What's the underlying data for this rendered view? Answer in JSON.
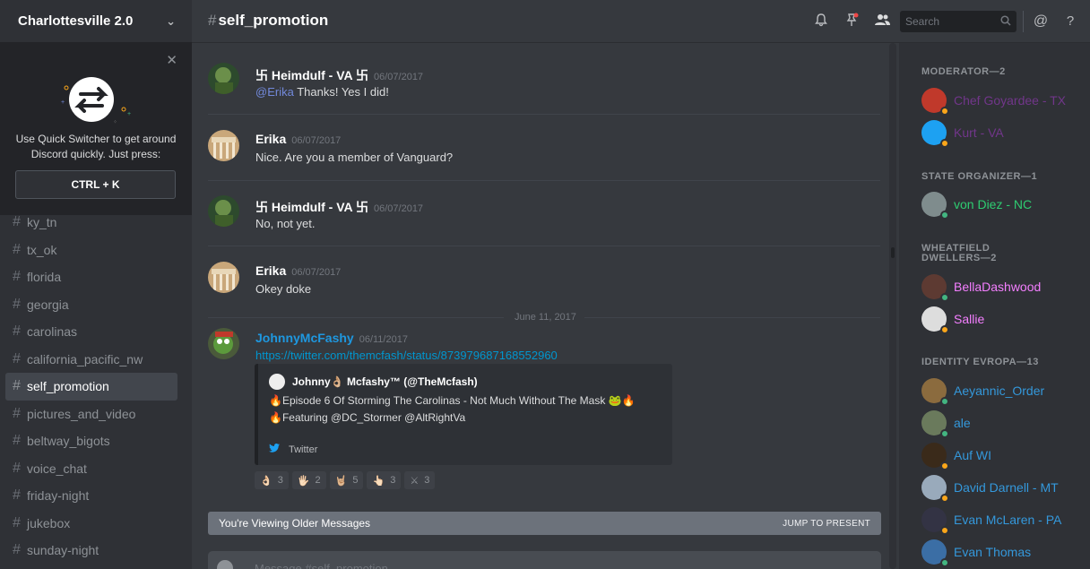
{
  "server": {
    "name": "Charlottesville 2.0"
  },
  "quick_switcher": {
    "text": "Use Quick Switcher to get around Discord quickly. Just press:",
    "shortcut": "CTRL + K"
  },
  "channels": [
    {
      "name": "ky_tn"
    },
    {
      "name": "tx_ok"
    },
    {
      "name": "florida"
    },
    {
      "name": "georgia"
    },
    {
      "name": "carolinas"
    },
    {
      "name": "california_pacific_nw"
    },
    {
      "name": "self_promotion",
      "active": true
    },
    {
      "name": "pictures_and_video"
    },
    {
      "name": "beltway_bigots"
    },
    {
      "name": "voice_chat"
    },
    {
      "name": "friday-night"
    },
    {
      "name": "jukebox"
    },
    {
      "name": "sunday-night"
    }
  ],
  "header": {
    "hash": "#",
    "channel": "self_promotion",
    "search_placeholder": "Search",
    "icons": [
      "bell-icon",
      "pin-icon",
      "members-icon",
      "search-icon",
      "mention-icon",
      "help-icon"
    ]
  },
  "messages": [
    {
      "author": "卐 Heimdulf - VA 卐",
      "time": "06/07/2017",
      "mention": "@Erika",
      "text": " Thanks! Yes I did!",
      "author_color": "#ffffff"
    },
    {
      "author": "Erika",
      "time": "06/07/2017",
      "text": "Nice. Are you a member of Vanguard?",
      "author_color": "#ffffff"
    },
    {
      "author": "卐 Heimdulf - VA 卐",
      "time": "06/07/2017",
      "text": "No, not yet.",
      "author_color": "#ffffff"
    },
    {
      "author": "Erika",
      "time": "06/07/2017",
      "text": "Okey doke",
      "author_color": "#ffffff"
    }
  ],
  "date_separator": "June 11, 2017",
  "last_message": {
    "author": "JohnnyMcFashy",
    "time": "06/11/2017",
    "link": "https://twitter.com/themcfash/status/873979687168552960",
    "author_color": "#1e98e0",
    "embed": {
      "author": "Johnny👌🏼 Mcfashy™ (@TheMcfash)",
      "line1": "🔥Episode 6 Of Storming The Carolinas - Not Much Without The Mask 🐸🔥",
      "line2": "🔥Featuring @DC_Stormer @AltRightVa",
      "footer": "Twitter"
    },
    "reactions": [
      {
        "emoji": "👌🏻",
        "count": "3"
      },
      {
        "emoji": "🖐🏻",
        "count": "2"
      },
      {
        "emoji": "🤘🏼",
        "count": "5"
      },
      {
        "emoji": "👆🏻",
        "count": "3"
      },
      {
        "emoji": "⚔",
        "count": "3"
      }
    ]
  },
  "older_bar": {
    "text": "You're Viewing Older Messages",
    "jump": "JUMP TO PRESENT"
  },
  "composer": {
    "placeholder": "Message #self_promotion"
  },
  "member_groups": [
    {
      "role": "MODERATOR—2",
      "members": [
        {
          "name": "Chef Goyardee - TX",
          "color": "#71368a",
          "status": "#faa61a",
          "avatar": "#c0392b"
        },
        {
          "name": "Kurt - VA",
          "color": "#71368a",
          "status": "#faa61a",
          "avatar": "#1da1f2"
        }
      ]
    },
    {
      "role": "STATE ORGANIZER—1",
      "members": [
        {
          "name": "von Diez - NC",
          "color": "#2ecc71",
          "status": "#43b581",
          "avatar": "#7f8c8d"
        }
      ]
    },
    {
      "role": "WHEATFIELD DWELLERS—2",
      "members": [
        {
          "name": "BellaDashwood",
          "color": "#f47fff",
          "status": "#43b581",
          "avatar": "#5d3a32"
        },
        {
          "name": "Sallie",
          "color": "#f47fff",
          "status": "#faa61a",
          "avatar": "#ddd"
        }
      ]
    },
    {
      "role": "IDENTITY EVROPA—13",
      "members": [
        {
          "name": "Aeyannic_Order",
          "color": "#3498db",
          "status": "#43b581",
          "avatar": "#8b6b3e"
        },
        {
          "name": "ale",
          "color": "#3498db",
          "status": "#43b581",
          "avatar": "#6a7a5c"
        },
        {
          "name": "Auf WI",
          "color": "#3498db",
          "status": "#faa61a",
          "avatar": "#3a2a1a"
        },
        {
          "name": "David Darnell - MT",
          "color": "#3498db",
          "status": "#faa61a",
          "avatar": "#9ab"
        },
        {
          "name": "Evan McLaren - PA",
          "color": "#3498db",
          "status": "#faa61a",
          "avatar": "#334"
        },
        {
          "name": "Evan Thomas",
          "color": "#3498db",
          "status": "#43b581",
          "avatar": "#3b6ea5"
        }
      ]
    }
  ]
}
